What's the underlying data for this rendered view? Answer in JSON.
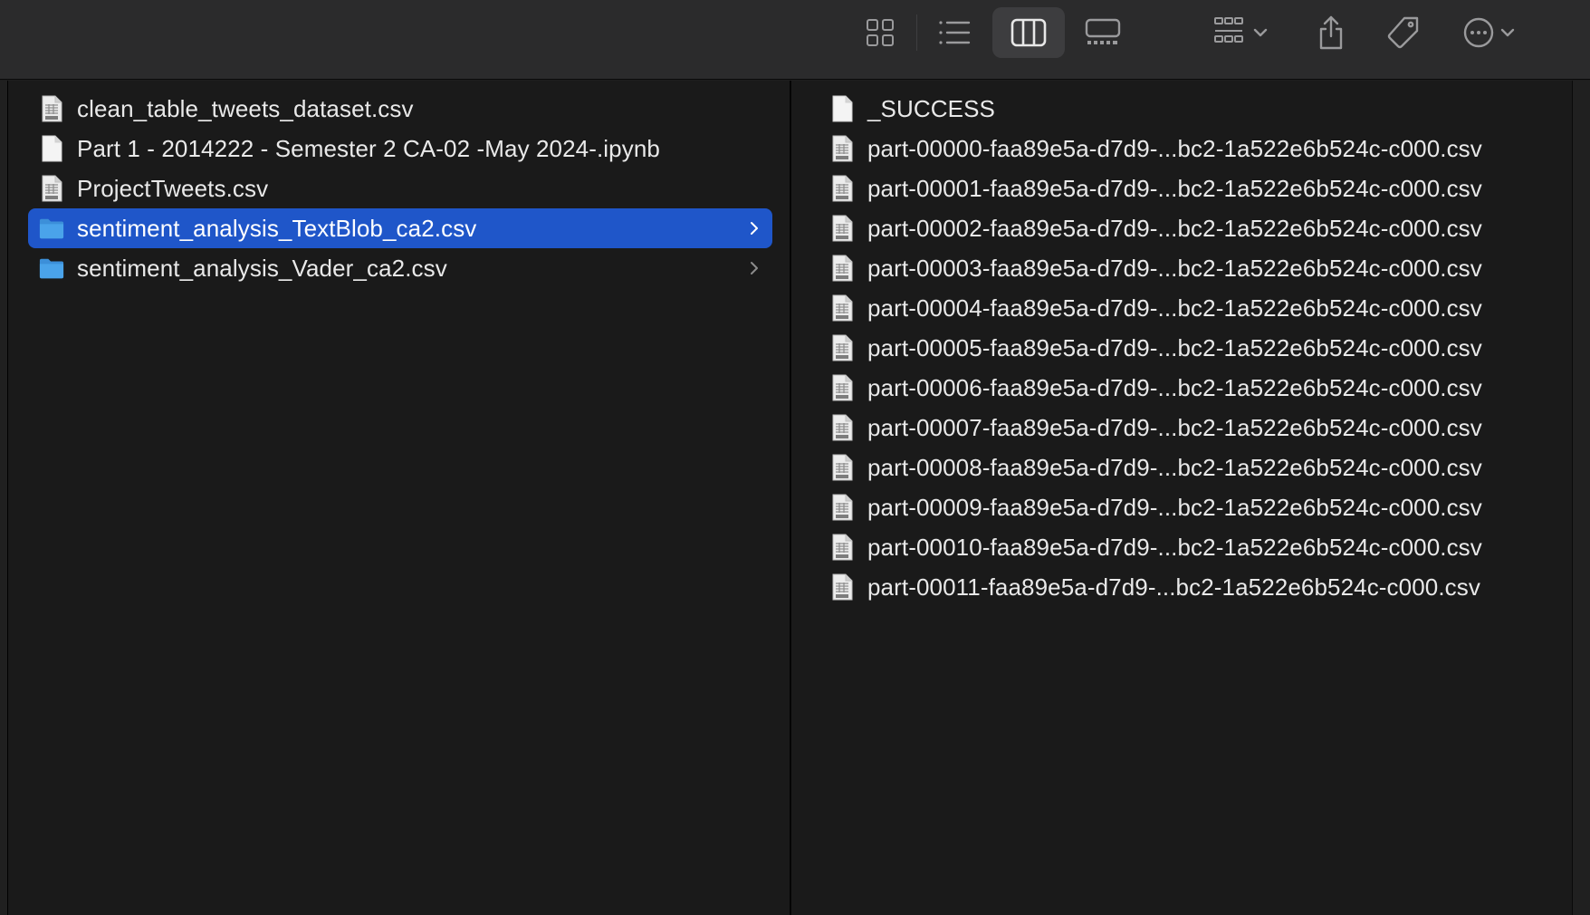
{
  "toolbar": {
    "buttons": [
      {
        "name": "icon-view-icon"
      },
      {
        "name": "list-view-icon"
      },
      {
        "name": "column-view-icon",
        "active": true
      },
      {
        "name": "gallery-view-icon"
      },
      {
        "name": "group-by-icon"
      },
      {
        "name": "share-icon"
      },
      {
        "name": "tag-icon"
      },
      {
        "name": "more-actions-icon"
      }
    ]
  },
  "colors": {
    "selection": "#1f56c9",
    "folder": "#4aa3ea",
    "background": "#1a1a1a",
    "toolbar": "#2b2b2c"
  },
  "left_column": {
    "items": [
      {
        "label": "clean_table_tweets_dataset.csv",
        "icon": "csv-file-icon"
      },
      {
        "label": "Part 1 - 2014222 - Semester 2 CA-02 -May 2024-.ipynb",
        "icon": "blank-file-icon"
      },
      {
        "label": "ProjectTweets.csv",
        "icon": "csv-file-icon"
      },
      {
        "label": "sentiment_analysis_TextBlob_ca2.csv",
        "icon": "folder-icon",
        "selected": true,
        "expandable": true
      },
      {
        "label": "sentiment_analysis_Vader_ca2.csv",
        "icon": "folder-icon",
        "expandable": true
      }
    ]
  },
  "right_column": {
    "items": [
      {
        "label": "_SUCCESS",
        "icon": "blank-file-icon"
      },
      {
        "label": "part-00000-faa89e5a-d7d9-...bc2-1a522e6b524c-c000.csv",
        "icon": "csv-file-icon"
      },
      {
        "label": "part-00001-faa89e5a-d7d9-...bc2-1a522e6b524c-c000.csv",
        "icon": "csv-file-icon"
      },
      {
        "label": "part-00002-faa89e5a-d7d9-...bc2-1a522e6b524c-c000.csv",
        "icon": "csv-file-icon"
      },
      {
        "label": "part-00003-faa89e5a-d7d9-...bc2-1a522e6b524c-c000.csv",
        "icon": "csv-file-icon"
      },
      {
        "label": "part-00004-faa89e5a-d7d9-...bc2-1a522e6b524c-c000.csv",
        "icon": "csv-file-icon"
      },
      {
        "label": "part-00005-faa89e5a-d7d9-...bc2-1a522e6b524c-c000.csv",
        "icon": "csv-file-icon"
      },
      {
        "label": "part-00006-faa89e5a-d7d9-...bc2-1a522e6b524c-c000.csv",
        "icon": "csv-file-icon"
      },
      {
        "label": "part-00007-faa89e5a-d7d9-...bc2-1a522e6b524c-c000.csv",
        "icon": "csv-file-icon"
      },
      {
        "label": "part-00008-faa89e5a-d7d9-...bc2-1a522e6b524c-c000.csv",
        "icon": "csv-file-icon"
      },
      {
        "label": "part-00009-faa89e5a-d7d9-...bc2-1a522e6b524c-c000.csv",
        "icon": "csv-file-icon"
      },
      {
        "label": "part-00010-faa89e5a-d7d9-...bc2-1a522e6b524c-c000.csv",
        "icon": "csv-file-icon"
      },
      {
        "label": "part-00011-faa89e5a-d7d9-...bc2-1a522e6b524c-c000.csv",
        "icon": "csv-file-icon"
      }
    ]
  }
}
